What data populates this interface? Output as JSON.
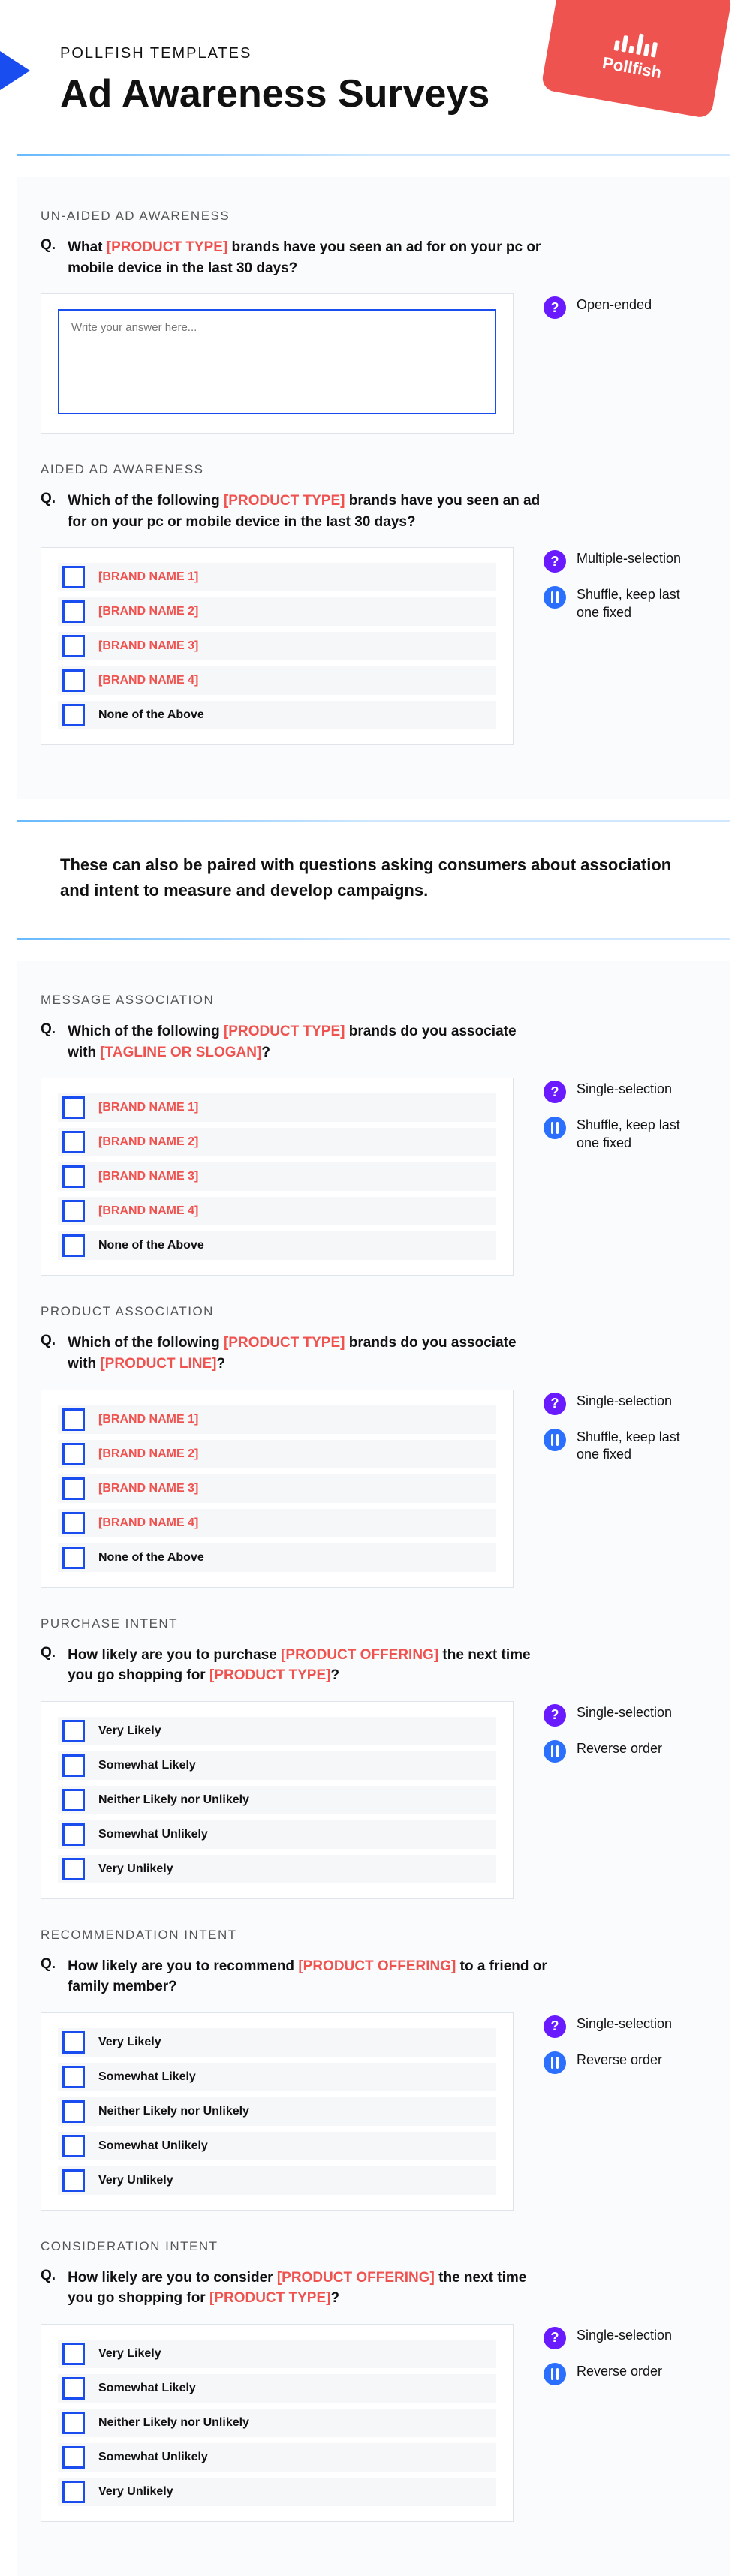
{
  "header": {
    "pre": "POLLFISH TEMPLATES",
    "title": "Ad Awareness Surveys",
    "badge_brand": "Pollfish"
  },
  "labels": {
    "q": "Q."
  },
  "annotations": {
    "open_ended": "Open-ended",
    "multi": "Multiple-selection",
    "single": "Single-selection",
    "shuffle_last": "Shuffle, keep last one fixed",
    "reverse": "Reverse order"
  },
  "mid_note": "These can also be paired with questions asking consumers about association and intent to measure and develop campaigns.",
  "sections": {
    "unaided": {
      "head": "UN-AIDED AD AWARENESS",
      "q_a": "What ",
      "q_ph1": "[PRODUCT TYPE]",
      "q_b": " brands have you seen an ad for on your pc or mobile device in the last 30 days?",
      "placeholder": "Write your answer here..."
    },
    "aided": {
      "head": "AIDED AD AWARENESS",
      "q_a": "Which of the following ",
      "q_ph1": "[PRODUCT TYPE]",
      "q_b": " brands have you seen an ad for on your pc or mobile device in the last 30 days?",
      "opts": [
        "[BRAND NAME 1]",
        "[BRAND NAME 2]",
        "[BRAND NAME 3]",
        "[BRAND NAME 4]"
      ],
      "opt_last": "None of the Above"
    },
    "msg": {
      "head": "MESSAGE ASSOCIATION",
      "q_a": "Which of the following ",
      "q_ph1": "[PRODUCT TYPE]",
      "q_b": " brands do you associate with ",
      "q_ph2": "[TAGLINE OR SLOGAN]",
      "q_c": "?",
      "opts": [
        "[BRAND NAME 1]",
        "[BRAND NAME 2]",
        "[BRAND NAME 3]",
        "[BRAND NAME 4]"
      ],
      "opt_last": "None of the Above"
    },
    "prod": {
      "head": "PRODUCT ASSOCIATION",
      "q_a": "Which of the following ",
      "q_ph1": "[PRODUCT TYPE]",
      "q_b": " brands do you associate with ",
      "q_ph2": "[PRODUCT LINE]",
      "q_c": "?",
      "opts": [
        "[BRAND NAME 1]",
        "[BRAND NAME 2]",
        "[BRAND NAME 3]",
        "[BRAND NAME 4]"
      ],
      "opt_last": "None of the Above"
    },
    "purchase": {
      "head": "PURCHASE INTENT",
      "q_a": "How likely are you to purchase ",
      "q_ph1": "[PRODUCT OFFERING]",
      "q_b": " the next time you go shopping for ",
      "q_ph2": "[PRODUCT TYPE]",
      "q_c": "?",
      "opts": [
        "Very Likely",
        "Somewhat Likely",
        "Neither Likely nor Unlikely",
        "Somewhat Unlikely",
        "Very Unlikely"
      ]
    },
    "recommend": {
      "head": "RECOMMENDATION INTENT",
      "q_a": "How likely are you to recommend ",
      "q_ph1": "[PRODUCT OFFERING]",
      "q_b": " to a friend or family member?",
      "opts": [
        "Very Likely",
        "Somewhat Likely",
        "Neither Likely nor Unlikely",
        "Somewhat Unlikely",
        "Very Unlikely"
      ]
    },
    "consider": {
      "head": "CONSIDERATION INTENT",
      "q_a": "How likely are you to consider ",
      "q_ph1": "[PRODUCT OFFERING]",
      "q_b": " the next time you go shopping for ",
      "q_ph2": "[PRODUCT TYPE]",
      "q_c": "?",
      "opts": [
        "Very Likely",
        "Somewhat Likely",
        "Neither Likely nor Unlikely",
        "Somewhat Unlikely",
        "Very Unlikely"
      ]
    }
  }
}
